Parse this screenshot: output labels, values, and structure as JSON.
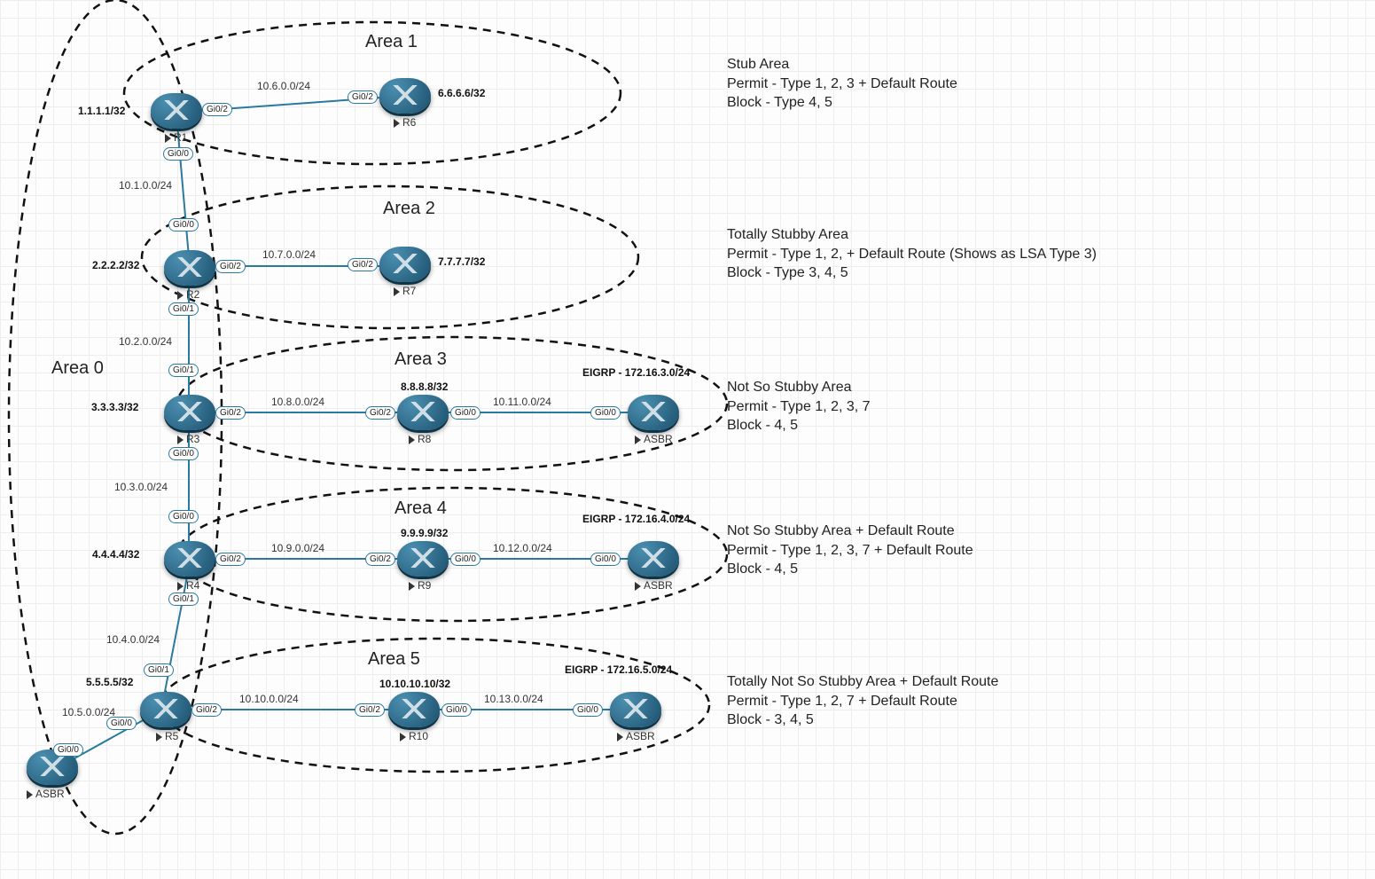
{
  "areas": {
    "a0": {
      "title": "Area 0"
    },
    "a1": {
      "title": "Area 1",
      "desc1": "Stub Area",
      "desc2": "Permit - Type 1, 2, 3 + Default Route",
      "desc3": "Block - Type 4, 5"
    },
    "a2": {
      "title": "Area 2",
      "desc1": "Totally Stubby Area",
      "desc2": "Permit - Type 1, 2, + Default Route (Shows as LSA Type 3)",
      "desc3": "Block - Type 3, 4, 5"
    },
    "a3": {
      "title": "Area 3",
      "desc1": "Not So Stubby Area",
      "desc2": "Permit - Type 1, 2, 3, 7",
      "desc3": "Block - 4, 5"
    },
    "a4": {
      "title": "Area 4",
      "desc1": "Not So Stubby Area + Default Route",
      "desc2": "Permit - Type 1, 2, 3, 7 + Default Route",
      "desc3": "Block - 4, 5"
    },
    "a5": {
      "title": "Area 5",
      "desc1": "Totally Not So Stubby Area + Default Route",
      "desc2": "Permit - Type 1, 2, 7 + Default Route",
      "desc3": "Block - 3, 4, 5"
    }
  },
  "routers": {
    "r1": {
      "name": "R1",
      "ip": "1.1.1.1/32"
    },
    "r2": {
      "name": "R2",
      "ip": "2.2.2.2/32"
    },
    "r3": {
      "name": "R3",
      "ip": "3.3.3.3/32"
    },
    "r4": {
      "name": "R4",
      "ip": "4.4.4.4/32"
    },
    "r5": {
      "name": "R5",
      "ip": "5.5.5.5/32"
    },
    "r6": {
      "name": "R6",
      "ip": "6.6.6.6/32"
    },
    "r7": {
      "name": "R7",
      "ip": "7.7.7.7/32"
    },
    "r8": {
      "name": "R8",
      "ip": "8.8.8.8/32"
    },
    "r9": {
      "name": "R9",
      "ip": "9.9.9.9/32"
    },
    "r10": {
      "name": "R10",
      "ip": "10.10.10.10/32"
    },
    "asbr3": {
      "name": "ASBR",
      "ext": "EIGRP - 172.16.3.0/24"
    },
    "asbr4": {
      "name": "ASBR",
      "ext": "EIGRP - 172.16.4.0/24"
    },
    "asbr5": {
      "name": "ASBR",
      "ext": "EIGRP - 172.16.5.0/24"
    },
    "asbr0": {
      "name": "ASBR"
    }
  },
  "links": {
    "r1r2": {
      "net": "10.1.0.0/24",
      "pa": "Gi0/0",
      "pb": "Gi0/0"
    },
    "r2r3": {
      "net": "10.2.0.0/24",
      "pa": "Gi0/1",
      "pb": "Gi0/1"
    },
    "r3r4": {
      "net": "10.3.0.0/24",
      "pa": "Gi0/0",
      "pb": "Gi0/0"
    },
    "r4r5": {
      "net": "10.4.0.0/24",
      "pa": "Gi0/1",
      "pb": "Gi0/1"
    },
    "r5asbr0": {
      "net": "10.5.0.0/24",
      "pa": "Gi0/0",
      "pb": "Gi0/0"
    },
    "r1r6": {
      "net": "10.6.0.0/24",
      "pa": "Gi0/2",
      "pb": "Gi0/2"
    },
    "r2r7": {
      "net": "10.7.0.0/24",
      "pa": "Gi0/2",
      "pb": "Gi0/2"
    },
    "r3r8": {
      "net": "10.8.0.0/24",
      "pa": "Gi0/2",
      "pb": "Gi0/2"
    },
    "r4r9": {
      "net": "10.9.0.0/24",
      "pa": "Gi0/2",
      "pb": "Gi0/2"
    },
    "r5r10": {
      "net": "10.10.0.0/24",
      "pa": "Gi0/2",
      "pb": "Gi0/2"
    },
    "r8asbr3": {
      "net": "10.11.0.0/24",
      "pa": "Gi0/0",
      "pb": "Gi0/0"
    },
    "r9asbr4": {
      "net": "10.12.0.0/24",
      "pa": "Gi0/0",
      "pb": "Gi0/0"
    },
    "r10asbr5": {
      "net": "10.13.0.0/24",
      "pa": "Gi0/0",
      "pb": "Gi0/0"
    }
  }
}
